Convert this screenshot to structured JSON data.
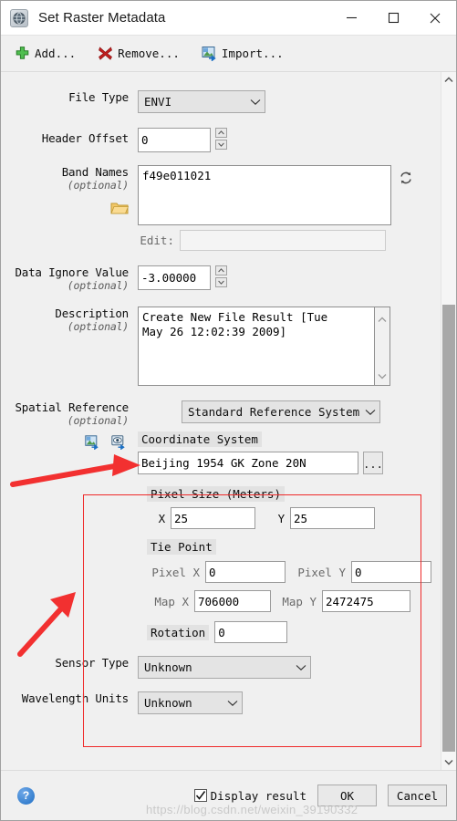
{
  "window": {
    "title": "Set Raster Metadata",
    "icon": "globe-icon",
    "minimize": "minimize-icon",
    "maximize": "maximize-icon",
    "close": "close-icon"
  },
  "toolbar": {
    "add_label": "Add...",
    "remove_label": "Remove...",
    "import_label": "Import..."
  },
  "form": {
    "file_type": {
      "label": "File Type",
      "value": "ENVI"
    },
    "header_offset": {
      "label": "Header Offset",
      "value": "0"
    },
    "band_names": {
      "label": "Band Names",
      "optional": "(optional)",
      "value": "f49e011021",
      "edit_label": "Edit:",
      "edit_value": ""
    },
    "data_ignore_value": {
      "label": "Data Ignore Value",
      "optional": "(optional)",
      "value": "-3.00000"
    },
    "description": {
      "label": "Description",
      "optional": "(optional)",
      "value": "Create New File Result [Tue\nMay 26 12:02:39 2009]"
    },
    "spatial_reference": {
      "label": "Spatial Reference",
      "optional": "(optional)",
      "value": "Standard Reference System"
    },
    "coordinate_system": {
      "label": "Coordinate System",
      "value": "Beijing 1954 GK Zone 20N",
      "browse_label": "..."
    },
    "pixel_size": {
      "label": "Pixel Size (Meters)",
      "x_label": "X",
      "x_value": "25",
      "y_label": "Y",
      "y_value": "25"
    },
    "tie_point": {
      "label": "Tie Point",
      "pixel_x_label": "Pixel X",
      "pixel_x_value": "0",
      "pixel_y_label": "Pixel Y",
      "pixel_y_value": "0",
      "map_x_label": "Map X",
      "map_x_value": "706000",
      "map_y_label": "Map Y",
      "map_y_value": "2472475"
    },
    "rotation": {
      "label": "Rotation",
      "value": "0"
    },
    "sensor_type": {
      "label": "Sensor Type",
      "value": "Unknown"
    },
    "wavelength_units": {
      "label": "Wavelength Units",
      "value": "Unknown"
    }
  },
  "footer": {
    "help": "?",
    "display_result_label": "Display result",
    "display_result_checked": true,
    "ok_label": "OK",
    "cancel_label": "Cancel"
  },
  "watermark": "https://blog.csdn.net/weixin_39190332",
  "colors": {
    "accent_red": "#ef2929",
    "add_green": "#3faa3f",
    "remove_red": "#b92020",
    "dialog_bg": "#f0f0f0"
  }
}
